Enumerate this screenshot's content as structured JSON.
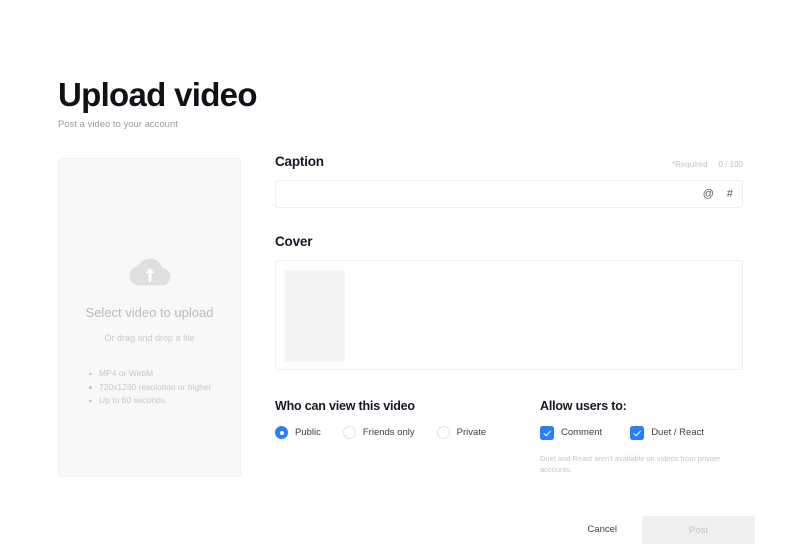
{
  "header": {
    "title": "Upload video",
    "subtitle": "Post a video to your account"
  },
  "upload_panel": {
    "icon": "cloud-upload-icon",
    "title": "Select video to upload",
    "subtitle": "Or drag and drop a file",
    "requirements": [
      "MP4 or WebM",
      "720x1280 resolution or higher",
      "Up to 60 seconds"
    ]
  },
  "caption": {
    "label": "Caption",
    "required_text": "*Required",
    "counter": "0 / 100",
    "value": "",
    "placeholder": "",
    "mention_icon": "@",
    "hashtag_icon": "#"
  },
  "cover": {
    "label": "Cover"
  },
  "visibility": {
    "title": "Who can view this video",
    "options": [
      {
        "label": "Public",
        "selected": true
      },
      {
        "label": "Friends only",
        "selected": false
      },
      {
        "label": "Private",
        "selected": false
      }
    ]
  },
  "permissions": {
    "title": "Allow users to:",
    "options": [
      {
        "label": "Comment",
        "checked": true
      },
      {
        "label": "Duet / React",
        "checked": true
      }
    ],
    "note": "Duet and React aren't available on videos from private accounts."
  },
  "footer": {
    "cancel_label": "Cancel",
    "post_label": "Post"
  },
  "colors": {
    "accent": "#2a7fff",
    "text": "#161823",
    "muted": "#c2c3c6",
    "panel_bg": "#f8f8f9",
    "disabled_bg": "#efeff0"
  }
}
